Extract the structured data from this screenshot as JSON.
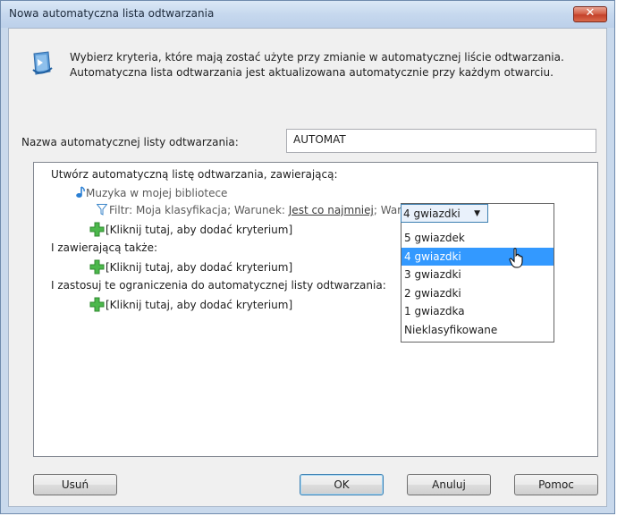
{
  "window": {
    "title": "Nowa automatyczna lista odtwarzania",
    "close_label": "✕"
  },
  "header": {
    "icon": "playlist-icon",
    "line1": "Wybierz kryteria, które mają zostać użyte przy zmianie w automatycznej liście odtwarzania.",
    "line2": "Automatyczna lista odtwarzania jest aktualizowana automatycznie przy każdym otwarciu."
  },
  "name_field": {
    "label": "Nazwa automatycznej listy odtwarzania:",
    "value": "AUTOMAT"
  },
  "criteria": {
    "create_heading": "Utwórz automatyczną listę odtwarzania, zawierającą:",
    "library_item": "Muzyka w mojej bibliotece",
    "filter": {
      "prefix": "Filtr: Moja klasyfikacja; Warunek:",
      "condition_link": "Jest co najmniej",
      "value_label": "; Wartość:",
      "selected_value": "4 gwiazdki"
    },
    "add_criterion_1": "[Kliknij tutaj, aby dodać kryterium]",
    "also_contains_heading": "I zawierającą także:",
    "add_criterion_2": "[Kliknij tutaj, aby dodać kryterium]",
    "restrictions_heading": "I zastosuj te ograniczenia do automatycznej listy odtwarzania:",
    "add_criterion_3": "[Kliknij tutaj, aby dodać kryterium]"
  },
  "dropdown_options": [
    {
      "label": "5 gwiazdek",
      "selected": false
    },
    {
      "label": "4 gwiazdki",
      "selected": true
    },
    {
      "label": "3 gwiazdki",
      "selected": false
    },
    {
      "label": "2 gwiazdki",
      "selected": false
    },
    {
      "label": "1 gwiazdka",
      "selected": false
    },
    {
      "label": "Nieklasyfikowane",
      "selected": false
    }
  ],
  "buttons": {
    "delete": "Usuń",
    "ok": "OK",
    "cancel": "Anuluj",
    "help": "Pomoc"
  },
  "colors": {
    "accent_blue": "#3399ff",
    "close_red": "#c4412a",
    "plus_green": "#3aa83a"
  }
}
